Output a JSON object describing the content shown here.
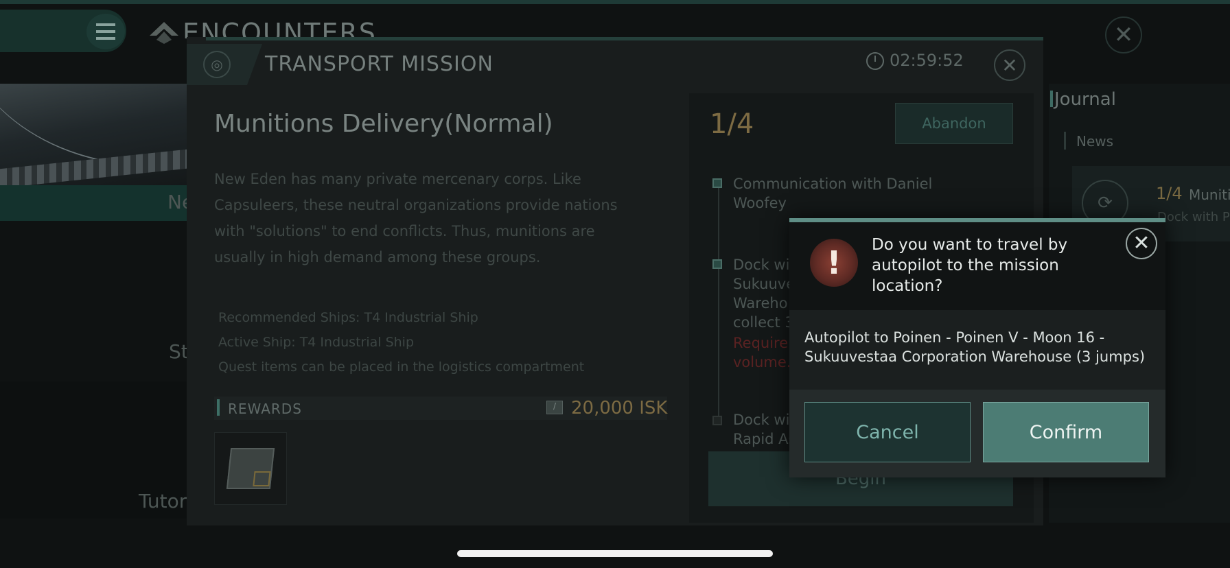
{
  "background": {
    "screen_title": "ENCOUNTERS",
    "card_labels": {
      "new": "Ne",
      "story": "St",
      "tutorial": "Tutor"
    },
    "journal": {
      "title": "Journal",
      "tab": "News",
      "item_progress": "1/4",
      "item_name": "Muniti",
      "item_sub": "Dock with P"
    }
  },
  "mission": {
    "window_title": "TRANSPORT MISSION",
    "timer": "02:59:52",
    "name": "Munitions Delivery(Normal)",
    "description": "New Eden has many private mercenary corps. Like Capsuleers, these neutral organizations provide nations with \"solutions\" to end conflicts. Thus, munitions are usually in high demand among these groups.",
    "recommended_ships": "Recommended Ships: T4 Industrial Ship",
    "active_ship": "Active Ship: T4 Industrial Ship",
    "quest_note": "Quest items can be placed in the logistics compartment",
    "rewards_label": "REWARDS",
    "isk_amount": "20,000 ISK",
    "step_counter": "1/4",
    "abandon_label": "Abandon",
    "steps": [
      {
        "lines": [
          "Communication with Daniel",
          "Woofey"
        ]
      },
      {
        "lines": [
          "Dock wi",
          "Sukuuve",
          "Wareho",
          "collect 3"
        ],
        "requirement": [
          "Require",
          "volume."
        ]
      },
      {
        "lines": [
          "Dock wi",
          "Rapid As"
        ]
      }
    ],
    "begin_label": "Begin"
  },
  "dialog": {
    "question": "Do you want to travel by autopilot to the mission location?",
    "body": "Autopilot to Poinen - Poinen V - Moon 16 - Sukuuvestaa Corporation Warehouse (3 jumps)",
    "cancel_label": "Cancel",
    "confirm_label": "Confirm",
    "warning_glyph": "!",
    "close_glyph": "✕",
    "accent_color": "#5f8e86",
    "warning_color": "#8a3f33"
  },
  "icons": {
    "menu": "hamburger-icon",
    "close": "close-icon",
    "timer": "clock-icon",
    "isk": "isk-icon",
    "mission_type": "location-icon"
  }
}
